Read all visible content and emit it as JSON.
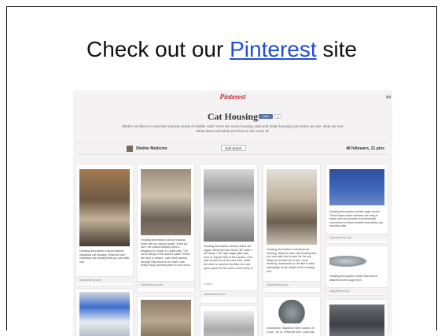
{
  "slide": {
    "headline_before": "Check out our ",
    "headline_link": "Pinterest",
    "headline_after": " site"
  },
  "pinterest": {
    "logo": "Pinterest",
    "top_right": "Ad",
    "board_title": "Cat Housing",
    "like_label": "Like",
    "like_count": "0",
    "description": "What's out there to meet the housing needs of shelter cats? Here are some housing units and foster housing care items we see, what we love about them and what we'd love to see more of.",
    "owner_name": "Shelter Medicine",
    "edit_button": "Edit Board",
    "stats": "48 followers, 21 pins",
    "pins": [
      {
        "description": "Housing description: indoor/outdoor individual cat housing. What we love: individual cat housing that you can walk into.",
        "footer": "Uploaded by user"
      },
      {
        "description": "Housing description: group housing room with an outdoor patch. What we love: the indoor/outdoor area is designed to house 3-4 adult cats. The cat is sitting in the outdoor patch. When the door is closed - cats have access through kitty doors in the wall. Cats really enjoy spending time on the porch.",
        "footer": "Uploaded by user"
      },
      {
        "description": "Housing description: double sided cat cages. What we love: these 36\" wide x 28\" deep x 28\" high cages give cats over 11 square feet of floor space. One side is used for a bed and food, while the other is used for the litter box and open space for the cat to move freely in.",
        "meta": "1 repin",
        "footer": "Uploaded by user"
      },
      {
        "description": "Housing description: individual cat housing. What we love: tall housing that you can walk into to care for the cat. What we would love to see: more shelving, hammocks or the like to take advantage of the height of the housing unit.",
        "footer": "Uploaded by user"
      },
      {
        "description": "Housing description: partial cage covers. These hand made versions are easy to make and can provide environmental enrichment in these smaller remodeled cat housing units.",
        "footer": "Uploaded by user"
      },
      {
        "description": "Housing description: bowls that can be attached to the cage form.",
        "footer": "ebay/feline.com"
      },
      {
        "description": "Description: Stainless Steel Clamp On Cups - 30 oz. What we love: cups that",
        "footer": ""
      }
    ]
  }
}
